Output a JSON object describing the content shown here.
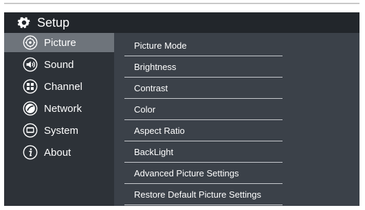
{
  "header": {
    "title": "Setup",
    "icon": "gear-icon"
  },
  "sidebar": {
    "items": [
      {
        "label": "Picture",
        "icon": "picture-icon",
        "active": true
      },
      {
        "label": "Sound",
        "icon": "speaker-icon",
        "active": false
      },
      {
        "label": "Channel",
        "icon": "channel-grid-icon",
        "active": false
      },
      {
        "label": "Network",
        "icon": "network-icon",
        "active": false
      },
      {
        "label": "System",
        "icon": "system-icon",
        "active": false
      },
      {
        "label": "About",
        "icon": "info-icon",
        "active": false
      }
    ]
  },
  "menu": {
    "items": [
      {
        "label": "Picture Mode"
      },
      {
        "label": "Brightness"
      },
      {
        "label": "Contrast"
      },
      {
        "label": "Color"
      },
      {
        "label": "Aspect Ratio"
      },
      {
        "label": "BackLight"
      },
      {
        "label": "Advanced Picture Settings"
      },
      {
        "label": "Restore Default Picture Settings"
      }
    ]
  },
  "colors": {
    "panel": "#3b4149",
    "header": "#22262b",
    "sidebar": "#2d3238",
    "active": "#6e747b",
    "text": "#ffffff",
    "divider": "#c9ccd0"
  }
}
